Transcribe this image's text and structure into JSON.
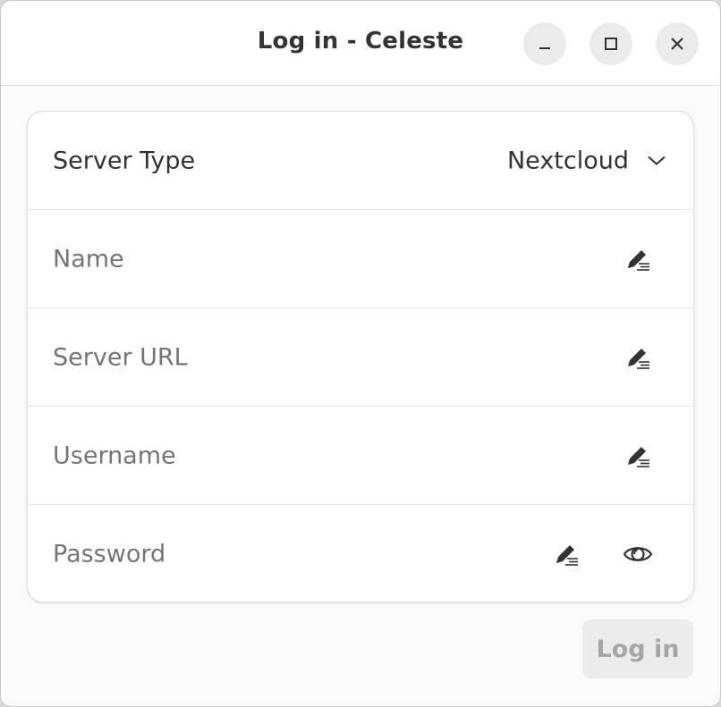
{
  "window": {
    "title": "Log in - Celeste"
  },
  "form": {
    "server_type": {
      "label": "Server Type",
      "value": "Nextcloud"
    },
    "name": {
      "placeholder": "Name"
    },
    "server_url": {
      "placeholder": "Server URL"
    },
    "username": {
      "placeholder": "Username"
    },
    "password": {
      "placeholder": "Password"
    }
  },
  "actions": {
    "login_label": "Log in"
  },
  "icons": {
    "minimize": "minimize-icon",
    "maximize": "maximize-icon",
    "close": "close-icon",
    "dropdown": "chevron-down-icon",
    "edit": "edit-text-icon",
    "reveal": "eye-icon"
  },
  "colors": {
    "window_bg": "#fafafa",
    "card_bg": "#ffffff",
    "text": "#333333",
    "placeholder": "#9a9a9a",
    "disabled_button_bg": "#ececec",
    "disabled_button_text": "#a6a6a6"
  }
}
